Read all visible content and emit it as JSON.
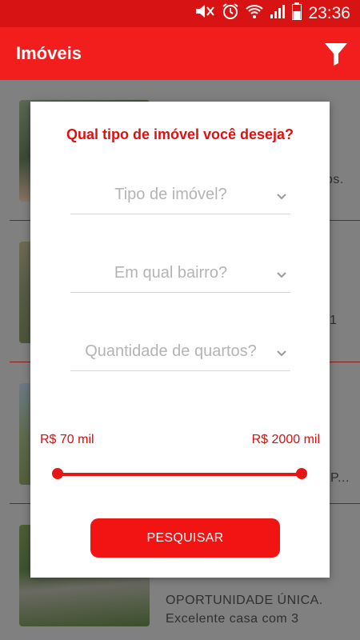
{
  "status_bar": {
    "time": "23:36",
    "icons": [
      "mute-icon",
      "alarm-icon",
      "wifi-icon",
      "signal-icon",
      "battery-icon"
    ]
  },
  "app_bar": {
    "title": "Imóveis",
    "filter_icon": "filter-icon"
  },
  "background_list": {
    "snippets": [
      "tos.",
      "1",
      "P...",
      "OPORTUNIDADE ÚNICA.",
      "Excelente casa com 3"
    ]
  },
  "dialog": {
    "title": "Qual tipo de imóvel você deseja?",
    "property_type": {
      "placeholder": "Tipo de imóvel?"
    },
    "neighborhood": {
      "placeholder": "Em qual bairro?"
    },
    "bedrooms": {
      "placeholder": "Quantidade de quartos?"
    },
    "price_range": {
      "min_label": "R$ 70 mil",
      "max_label": "R$ 2000 mil",
      "min_fraction": 0.0,
      "max_fraction": 1.0
    },
    "search_label": "PESQUISAR"
  },
  "colors": {
    "primary": "#f21d1d",
    "status_bar": "#d81313",
    "accent_text": "#e01010"
  }
}
